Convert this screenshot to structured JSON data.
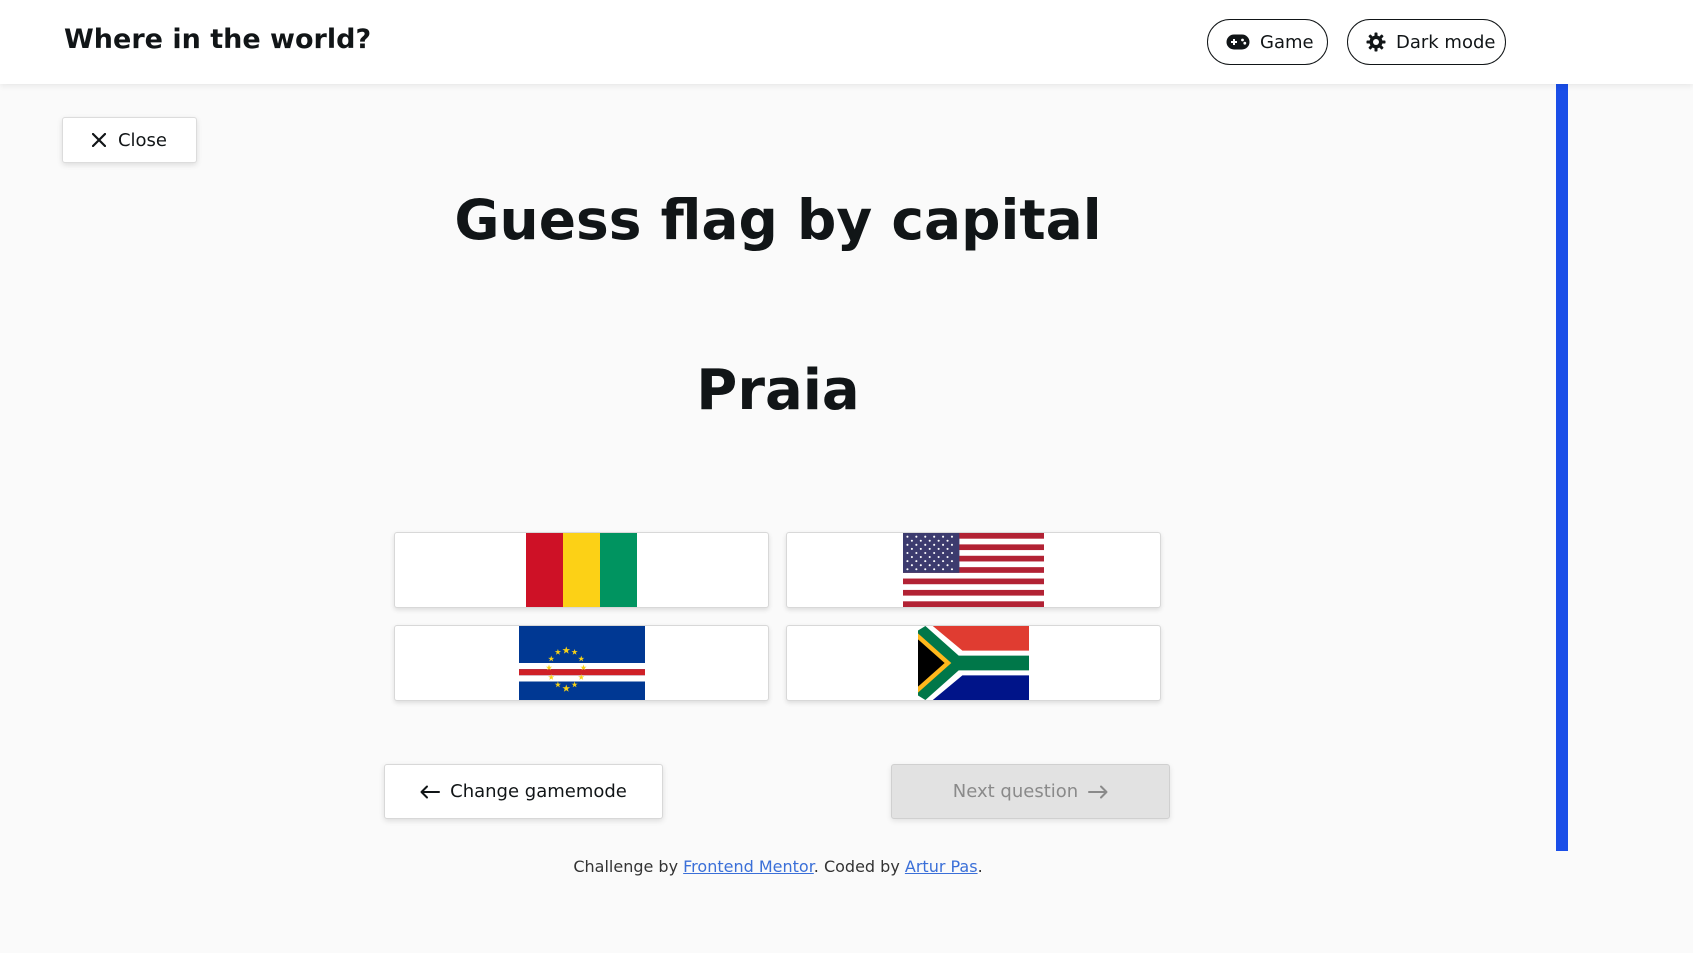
{
  "header": {
    "title": "Where in the world?",
    "game_label": "Game",
    "dark_mode_label": "Dark mode"
  },
  "close_label": "Close",
  "quiz": {
    "title": "Guess flag by capital",
    "capital": "Praia",
    "options": [
      {
        "flag": "guinea-flag"
      },
      {
        "flag": "usa-flag"
      },
      {
        "flag": "cape-verde-flag"
      },
      {
        "flag": "south-africa-flag"
      }
    ]
  },
  "nav": {
    "change_label": "Change gamemode",
    "next_label": "Next question"
  },
  "footer": {
    "challenge_prefix": "Challenge by ",
    "challenge_link": "Frontend Mentor",
    "coded_prefix": ". Coded by ",
    "coded_link": "Artur Pas",
    "suffix": "."
  },
  "colors": {
    "accent_strip": "#1a4ee8",
    "link": "#3a6fd8",
    "text": "#111517",
    "background": "#fafafa"
  }
}
